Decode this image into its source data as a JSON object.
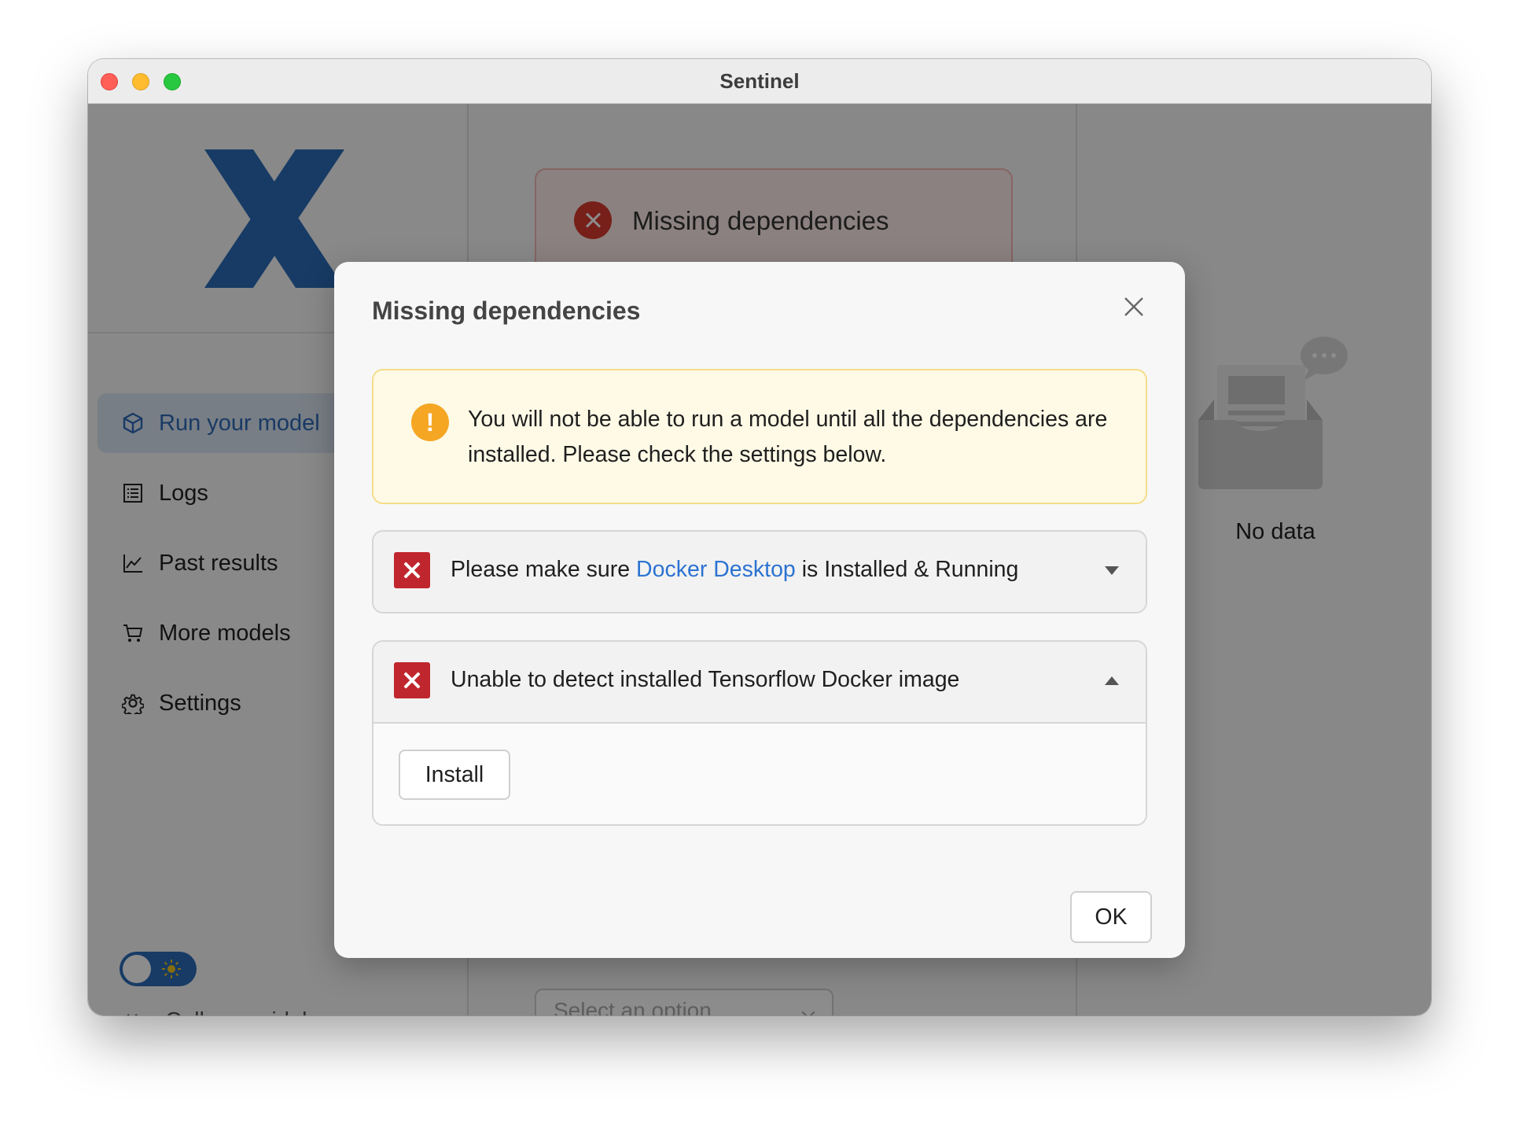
{
  "window": {
    "title": "Sentinel"
  },
  "sidebar": {
    "logo": "x-logo",
    "items": [
      {
        "label": "Run your model",
        "icon": "model-cube-icon",
        "active": true
      },
      {
        "label": "Logs",
        "icon": "list-icon"
      },
      {
        "label": "Past results",
        "icon": "line-chart-icon"
      },
      {
        "label": "More models",
        "icon": "cart-icon"
      },
      {
        "label": "Settings",
        "icon": "gear-icon"
      }
    ],
    "theme_toggle": {
      "state": "light",
      "icon": "sun-icon"
    },
    "collapse_label": "Collapse sidebar"
  },
  "main": {
    "alert_title": "Missing dependencies",
    "select_placeholder": "Select an option"
  },
  "right_panel": {
    "empty_text": "No data"
  },
  "modal": {
    "title": "Missing dependencies",
    "warning": "You will not be able to run a model until all the dependencies are installed. Please check the settings below.",
    "dependencies": [
      {
        "text_before": "Please make sure ",
        "link": "Docker Desktop",
        "text_after": " is Installed & Running",
        "status": "error",
        "expanded": false
      },
      {
        "text": "Unable to detect installed Tensorflow Docker image",
        "status": "error",
        "expanded": true,
        "action_label": "Install"
      }
    ],
    "ok_label": "OK"
  },
  "colors": {
    "accent": "#2c73d2",
    "error": "#c0262d",
    "warning": "#f5a623",
    "warning_bg": "#fefae6",
    "logo": "#2b6cb8"
  }
}
